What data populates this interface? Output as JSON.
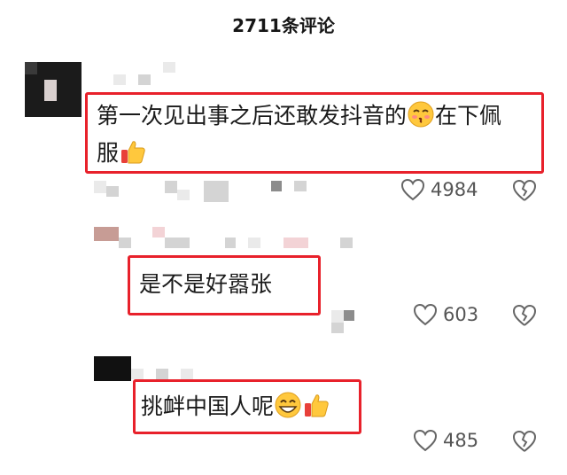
{
  "header": {
    "title": "2711条评论"
  },
  "comments": [
    {
      "text": "第一次见出事之后还敢发抖音的",
      "text_after_emoji": "在下佩",
      "text_line2": "服",
      "emoji_1": "kiss-face-icon",
      "emoji_2": "thumbs-up-icon",
      "likes": "4984"
    },
    {
      "text": "是不是好嚣张",
      "likes": "603"
    },
    {
      "text": "挑衅中国人呢",
      "emoji_1": "grinning-face-icon",
      "emoji_2": "thumbs-up-icon",
      "likes": "485"
    }
  ],
  "colors": {
    "highlight": "#e8212b",
    "icon": "#666666"
  }
}
